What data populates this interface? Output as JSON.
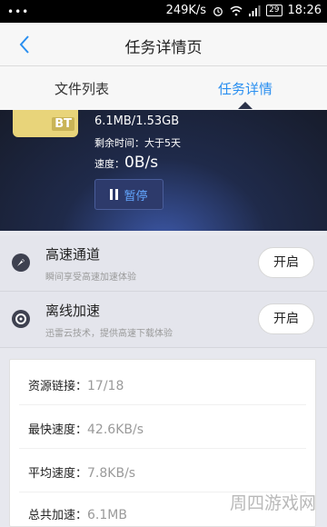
{
  "status_bar": {
    "dots": "•••",
    "network_speed": "249K/s",
    "battery": "29",
    "time": "18:26"
  },
  "header": {
    "title": "任务详情页"
  },
  "tabs": [
    {
      "label": "文件列表",
      "active": false
    },
    {
      "label": "任务详情",
      "active": true
    }
  ],
  "task": {
    "file_badge": "BT",
    "size_progress": "6.1MB/1.53GB",
    "remaining": "剩余时间：大于5天",
    "speed_label": "速度：",
    "speed_value": "0B/s",
    "pause_label": "暂停"
  },
  "features": [
    {
      "title": "高速通道",
      "desc": "瞬间享受高速加速体验",
      "button": "开启",
      "icon": "rocket-icon"
    },
    {
      "title": "离线加速",
      "desc": "迅雷云技术，提供高速下载体验",
      "button": "开启",
      "icon": "cloud-icon"
    }
  ],
  "stats": [
    {
      "label": "资源链接：",
      "value": "17/18"
    },
    {
      "label": "最快速度：",
      "value": "42.6KB/s"
    },
    {
      "label": "平均速度：",
      "value": "7.8KB/s"
    },
    {
      "label": "总共加速：",
      "value": "6.1MB"
    }
  ],
  "watermark": "周四游戏网",
  "colors": {
    "accent": "#2a8ff0",
    "dark_header": "#1f2a4a"
  }
}
